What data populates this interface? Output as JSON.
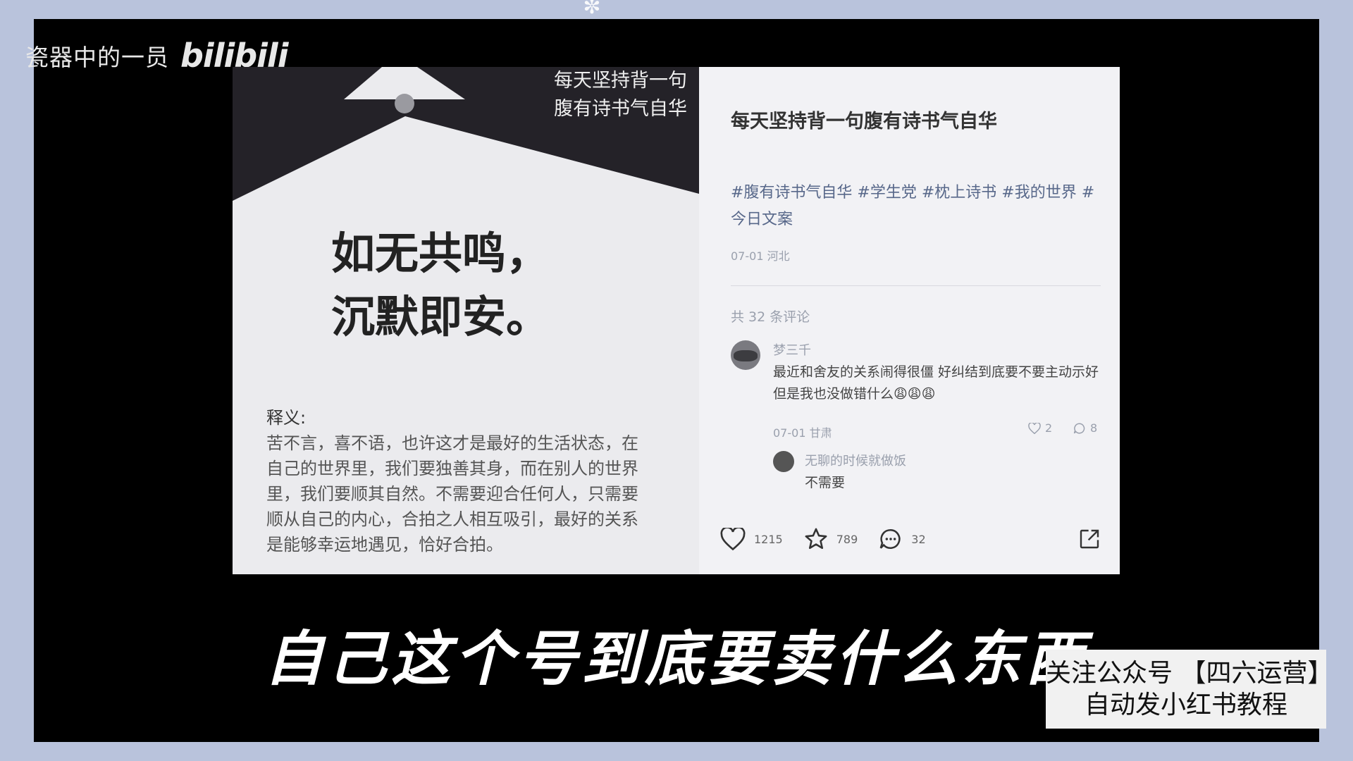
{
  "watermark": {
    "username": "瓷器中的一员",
    "logo": "bilibili"
  },
  "poster": {
    "motto": [
      "每天坚持背一句",
      "腹有诗书气自华"
    ],
    "quote": [
      "如无共鸣，",
      "沉默即安。"
    ],
    "explanation_label": "释义:",
    "explanation_lines": [
      "苦不言，喜不语，也许这才是最好的生活状态，在",
      "自己的世界里，我们要独善其身，而在别人的世界",
      "里，我们要顺其自然。不需要迎合任何人，只需要",
      "顺从自己的内心，合拍之人相互吸引，最好的关系",
      "是能够幸运地遇见，恰好合拍。"
    ]
  },
  "note": {
    "title": "每天坚持背一句腹有诗书气自华",
    "tags": "#腹有诗书气自华 #学生党 #枕上诗书 #我的世界 #今日文案",
    "date_location": "07-01 河北",
    "comments_count": "共 32 条评论",
    "comments": [
      {
        "user": "梦三千",
        "text": "最近和舍友的关系闹得很僵 好纠结到底要不要主动示好 但是我也没做错什么😩😩😩",
        "meta": "07-01 甘肃",
        "likes": "2",
        "replies": "8"
      },
      {
        "user": "无聊的时候就做饭",
        "text": "不需要"
      }
    ],
    "actions": {
      "likes": "1215",
      "stars": "789",
      "comments": "32"
    }
  },
  "subtitle": "自己这个号到底要卖什么东西",
  "promo": {
    "line1": "关注公众号 【四六运营】",
    "line2": "自动发小红书教程"
  }
}
